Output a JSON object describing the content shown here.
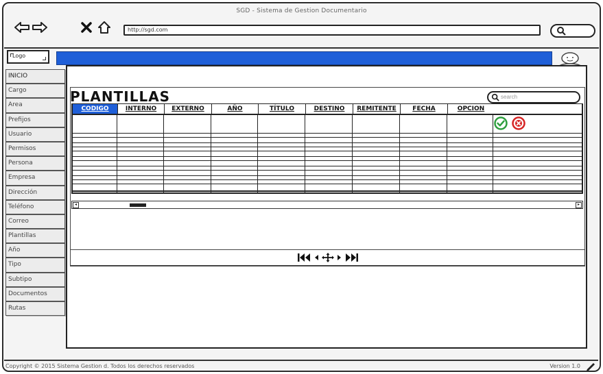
{
  "window": {
    "title": "SGD - Sistema de Gestion Documentario",
    "url": "http://sgd.com"
  },
  "app": {
    "logo": "Logo",
    "sidebar": {
      "items": [
        {
          "label": "INICIO"
        },
        {
          "label": "Cargo"
        },
        {
          "label": "Area"
        },
        {
          "label": "Prefijos"
        },
        {
          "label": "Usuario"
        },
        {
          "label": "Permisos"
        },
        {
          "label": "Persona"
        },
        {
          "label": "Empresa"
        },
        {
          "label": "Dirección"
        },
        {
          "label": "Teléfono"
        },
        {
          "label": "Correo"
        },
        {
          "label": "Plantillas"
        },
        {
          "label": "Año"
        },
        {
          "label": "Tipo"
        },
        {
          "label": "Subtipo"
        },
        {
          "label": "Documentos"
        },
        {
          "label": "Rutas"
        }
      ]
    },
    "page": {
      "title": "PLANTILLAS",
      "search_placeholder": "search",
      "columns": [
        "CODIGO",
        "INTERNO",
        "EXTERNO",
        "AÑO",
        "TÍTULO",
        "DESTINO",
        "REMITENTE",
        "FECHA",
        "OPCION"
      ],
      "active_column": "CODIGO"
    },
    "footer": {
      "copyright": "Copyright © 2015 Sistema Gestion d. Todos los derechos reservados",
      "version": "Version 1.0"
    }
  },
  "colors": {
    "accent": "#1f5fd8",
    "approve": "#2e9e3e",
    "reject": "#d62424"
  }
}
